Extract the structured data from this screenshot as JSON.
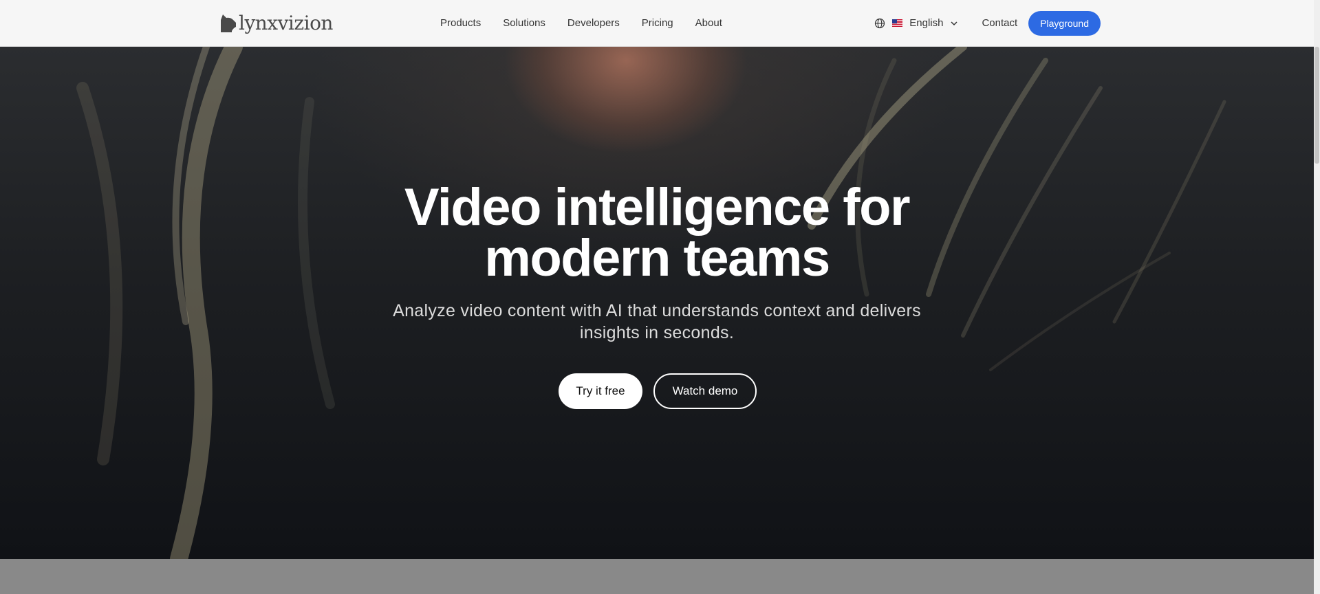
{
  "brand": {
    "name": "lynxvizion",
    "logo_icon": "lynx-head-icon"
  },
  "nav": {
    "items": [
      {
        "label": "Products"
      },
      {
        "label": "Solutions"
      },
      {
        "label": "Developers"
      },
      {
        "label": "Pricing"
      },
      {
        "label": "About"
      }
    ]
  },
  "language": {
    "icon": "globe-icon",
    "flag": "us-flag-icon",
    "label": "English",
    "chevron": "chevron-down-icon"
  },
  "contact": {
    "label": "Contact"
  },
  "playground": {
    "label": "Playground",
    "color": "#2d6ae3"
  },
  "hero": {
    "headline_line1": "Video intelligence for",
    "headline_line2": "modern teams",
    "subtitle": "Analyze video content with AI that understands context and delivers insights in seconds.",
    "primary_cta": "Try it free",
    "secondary_cta": "Watch demo"
  }
}
